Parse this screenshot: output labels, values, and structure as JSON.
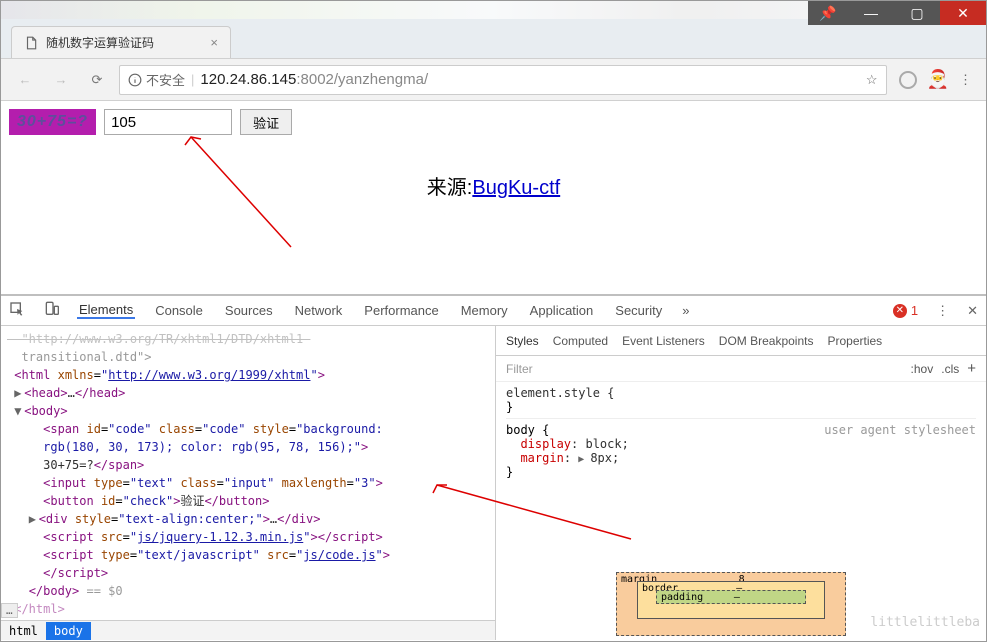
{
  "window": {
    "min": "—",
    "max": "▢",
    "close": "✕",
    "pin": "📌"
  },
  "tab": {
    "title": "随机数字运算验证码",
    "close": "×"
  },
  "address": {
    "insecure_label": "不安全",
    "host": "120.24.86.145",
    "port": ":8002",
    "path": "/yanzhengma/"
  },
  "page": {
    "code_text": "30+75=?",
    "input_value": "105",
    "verify_label": "验证",
    "source_prefix": "来源:",
    "source_link": "BugKu-ctf"
  },
  "devtools": {
    "tabs": [
      "Elements",
      "Console",
      "Sources",
      "Network",
      "Performance",
      "Memory",
      "Application",
      "Security"
    ],
    "more": "»",
    "error_count": "1",
    "dots": "⋮",
    "close": "✕",
    "elements": {
      "dtd_frag": "  http://www.w3.org/TR/xhtml1/DTD/xhtml1-transitional.dtd\">",
      "html_open": "<html xmlns=\"http://www.w3.org/1999/xhtml\">",
      "head": "<head>…</head>",
      "body_open": "<body>",
      "span_line": "<span id=\"code\" class=\"code\" style=\"background: rgb(180, 30, 173); color: rgb(95, 78, 156);\">30+75=?</span>",
      "input_line": "<input type=\"text\" class=\"input\" maxlength=\"3\">",
      "button_line": "<button id=\"check\">验证</button>",
      "div_line": "<div style=\"text-align:center;\">…</div>",
      "script1": "<script src=\"js/jquery-1.12.3.min.js\"></​script>",
      "script2": "<script type=\"text/javascript\" src=\"js/code.js\"></​script>",
      "body_close": "</body>",
      "eq": "== $0",
      "html_close": "</html>",
      "crumb1": "html",
      "crumb2": "body"
    },
    "styles": {
      "tabs": [
        "Styles",
        "Computed",
        "Event Listeners",
        "DOM Breakpoints",
        "Properties"
      ],
      "filter": "Filter",
      "hov": ":hov",
      "cls": ".cls",
      "plus": "+",
      "element_style": "element.style {",
      "brace": "}",
      "body_sel": "body {",
      "ua_label": "user agent stylesheet",
      "display_prop": "display",
      "display_val": ": block;",
      "margin_prop": "margin",
      "margin_val": "8px;",
      "bm_margin": "margin",
      "bm_margin_n": "8",
      "bm_border": "border",
      "bm_border_n": "–",
      "bm_padding": "padding",
      "bm_padding_n": "–"
    }
  },
  "watermark": "littlelittleba"
}
